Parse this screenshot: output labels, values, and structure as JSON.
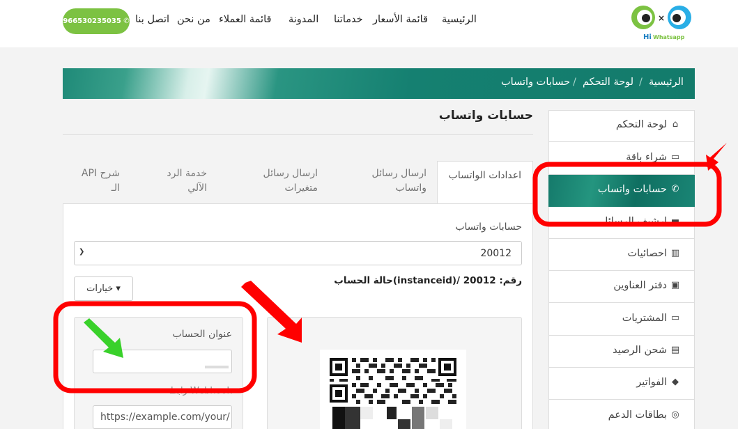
{
  "header": {
    "logo_text": "Hi Whatsapp",
    "nav": [
      "الرئيسية",
      "قائمة الأسعار",
      "خدماتنا",
      "المدونة",
      "قائمة العملاء",
      "من نحن",
      "اتصل بنا"
    ],
    "phone": "966530235035"
  },
  "breadcrumb": [
    "الرئيسية",
    "لوحة التحكم",
    "حسابات واتساب"
  ],
  "sidebar": {
    "items": [
      {
        "label": "لوحة التحكم",
        "icon": "home-icon"
      },
      {
        "label": "شراء باقة",
        "icon": "basket-icon"
      },
      {
        "label": "حسابات واتساب",
        "icon": "whatsapp-icon",
        "active": true
      },
      {
        "label": "ارشيف الرسائل",
        "icon": "archive-icon"
      },
      {
        "label": "احصائيات",
        "icon": "bar-chart-icon"
      },
      {
        "label": "دفتر العناوين",
        "icon": "address-book-icon"
      },
      {
        "label": "المشتريات",
        "icon": "basket-icon"
      },
      {
        "label": "شحن الرصيد",
        "icon": "credit-card-icon"
      },
      {
        "label": "الفواتير",
        "icon": "tags-icon"
      },
      {
        "label": "بطاقات الدعم",
        "icon": "support-icon"
      }
    ]
  },
  "main": {
    "title": "حسابات واتساب",
    "tabs": [
      {
        "label": "اعدادات الواتساب",
        "active": true
      },
      {
        "label": "ارسال رسائل واتساب"
      },
      {
        "label": "ارسال رسائل متغيرات"
      },
      {
        "label": "خدمة الرد الآلي"
      },
      {
        "label": "API شرح الـ"
      }
    ],
    "account_label": "حسابات واتساب",
    "account_value": "20012",
    "status_text": "حالة الحساب(instanceid)/ رقم: 20012",
    "options_button": "خيارات",
    "form": {
      "title_label": "عنوان الحساب",
      "title_value": "",
      "webhook_label": "رابط Webhook",
      "webhook_placeholder": "https://example.com/your/"
    }
  },
  "colors": {
    "brand_teal": "#137b6b",
    "phone_green": "#7cc242",
    "annotation_red": "#ff0000",
    "annotation_green": "#39d12a"
  }
}
